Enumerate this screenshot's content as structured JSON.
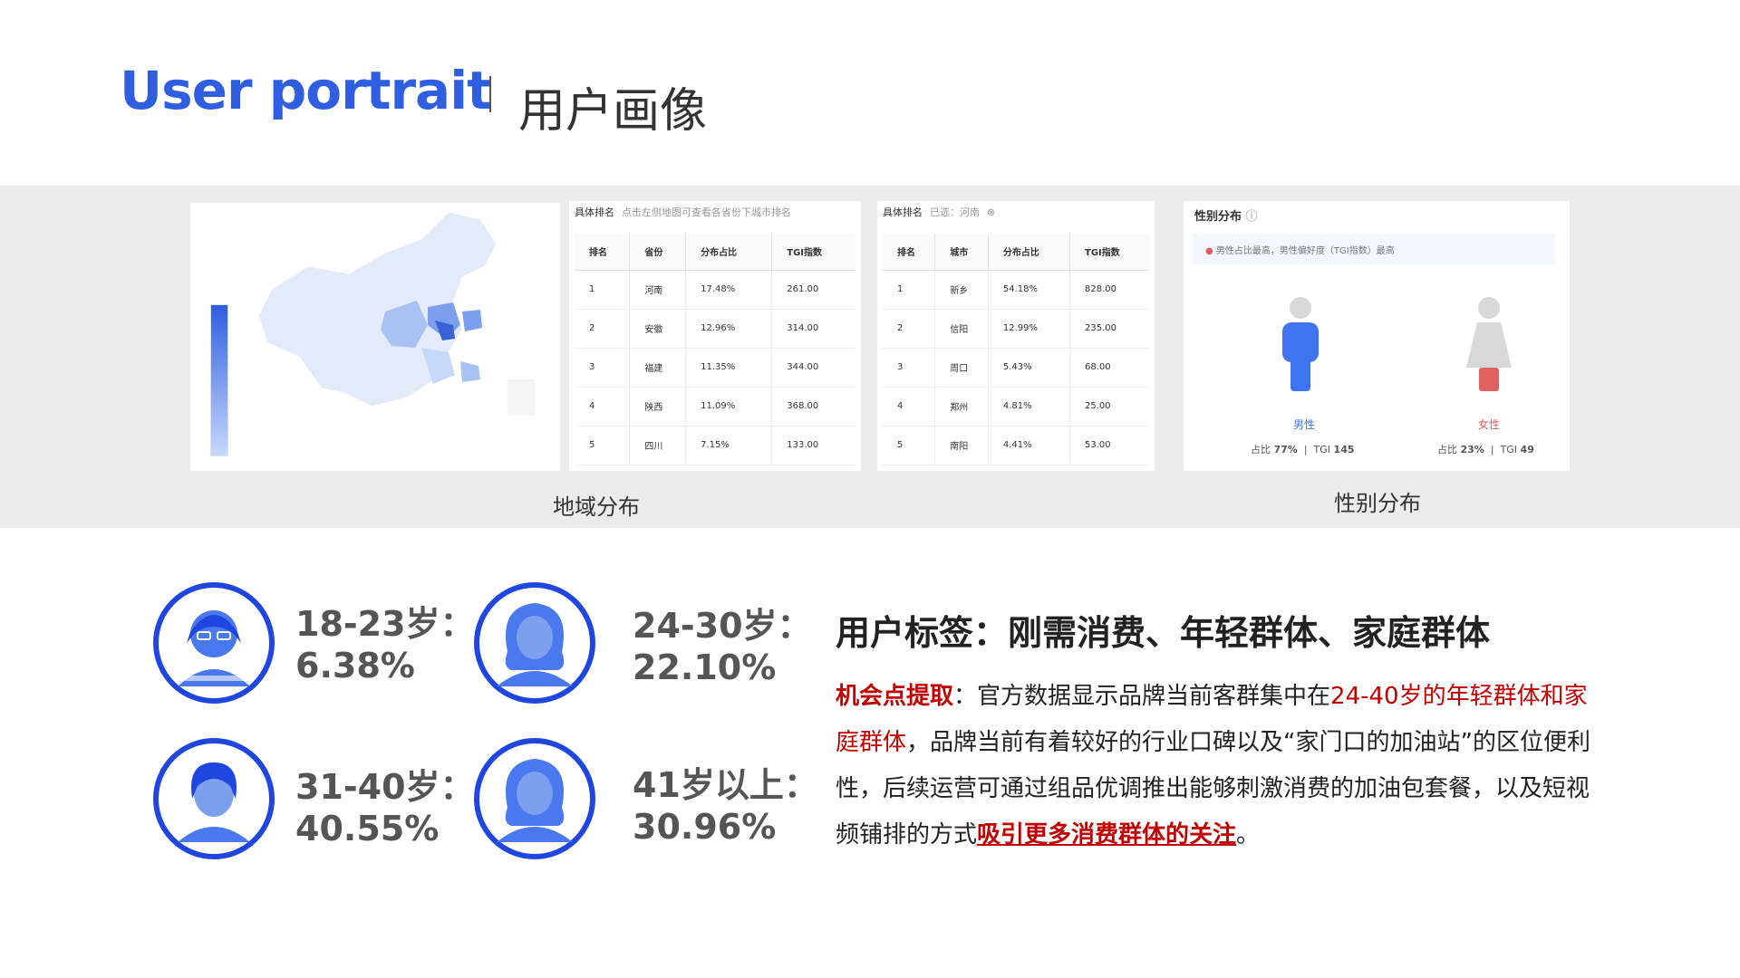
{
  "header": {
    "title_en": "User portrait",
    "title_cn": "用户画像"
  },
  "region": {
    "caption": "地域分布",
    "province_table": {
      "heading": "具体排名",
      "subheading": "点击左侧地图可查看各省份下城市排名",
      "columns": [
        "排名",
        "省份",
        "分布占比",
        "TGI指数"
      ],
      "rows": [
        [
          "1",
          "河南",
          "17.48%",
          "261.00"
        ],
        [
          "2",
          "安徽",
          "12.96%",
          "314.00"
        ],
        [
          "3",
          "福建",
          "11.35%",
          "344.00"
        ],
        [
          "4",
          "陕西",
          "11.09%",
          "368.00"
        ],
        [
          "5",
          "四川",
          "7.15%",
          "133.00"
        ]
      ]
    },
    "city_table": {
      "heading": "具体排名",
      "subheading": "已选：河南",
      "columns": [
        "排名",
        "城市",
        "分布占比",
        "TGI指数"
      ],
      "rows": [
        [
          "1",
          "新乡",
          "54.18%",
          "828.00"
        ],
        [
          "2",
          "信阳",
          "12.99%",
          "235.00"
        ],
        [
          "3",
          "周口",
          "5.43%",
          "68.00"
        ],
        [
          "4",
          "郑州",
          "4.81%",
          "25.00"
        ],
        [
          "5",
          "南阳",
          "4.41%",
          "53.00"
        ]
      ]
    }
  },
  "gender": {
    "caption": "性别分布",
    "panel_title": "性别分布",
    "note": "男性占比最高，男性偏好度（TGI指数）最高",
    "male": {
      "label": "男性",
      "share_label": "占比",
      "share": "77%",
      "tgi_label": "TGI",
      "tgi": "145"
    },
    "female": {
      "label": "女性",
      "share_label": "占比",
      "share": "23%",
      "tgi_label": "TGI",
      "tgi": "49"
    },
    "colors": {
      "male": "#3f74f0",
      "female": "#e06060"
    }
  },
  "age": [
    {
      "range": "18-23岁：",
      "percent": "6.38%",
      "icon": "woman-glasses-icon"
    },
    {
      "range": "24-30岁：",
      "percent": "22.10%",
      "icon": "woman-curly-hair-icon"
    },
    {
      "range": "31-40岁：",
      "percent": "40.55%",
      "icon": "woman-short-hair-icon"
    },
    {
      "range": "41岁以上：",
      "percent": "30.96%",
      "icon": "woman-curly-hair-icon"
    }
  ],
  "tags": {
    "title": "用户标签：刚需消费、年轻群体、家庭群体",
    "lead": "机会点提取",
    "p1": "：官方数据显示品牌当前客群集中在",
    "highlight1": "24-40岁的年轻群体和家庭群体",
    "p2": "，品牌当前有着较好的行业口碑以及“家门口的加油站”的区位便利性，后续运营可通过组品优调推出能够刺激消费的加油包套餐，以及短视频铺排的方式",
    "highlight2": "吸引更多消费群体的关注",
    "p3": "。"
  },
  "colors": {
    "brand_blue": "#2f5fe0",
    "ring_blue": "#1f47e0",
    "accent_red": "#c00000",
    "band_grey": "#ececec"
  }
}
